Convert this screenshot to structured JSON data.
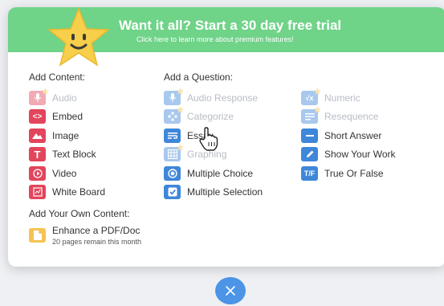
{
  "banner": {
    "title": "Want it all? Start a 30 day free trial",
    "subtitle": "Click here to learn more about premium features!"
  },
  "add_content": {
    "heading": "Add Content:",
    "items": [
      {
        "label": "Audio",
        "icon": "microphone-icon",
        "disabled": true,
        "premium": true
      },
      {
        "label": "Embed",
        "icon": "code-brackets-icon",
        "disabled": false
      },
      {
        "label": "Image",
        "icon": "mountain-image-icon",
        "disabled": false
      },
      {
        "label": "Text Block",
        "icon": "letter-t-icon",
        "disabled": false
      },
      {
        "label": "Video",
        "icon": "play-circle-icon",
        "disabled": false
      },
      {
        "label": "White Board",
        "icon": "whiteboard-icon",
        "disabled": false
      }
    ]
  },
  "add_question": {
    "heading": "Add a Question:",
    "col1": [
      {
        "label": "Audio Response",
        "icon": "microphone-icon",
        "disabled": true,
        "premium": true
      },
      {
        "label": "Categorize",
        "icon": "categorize-icon",
        "disabled": true,
        "premium": true
      },
      {
        "label": "Essay",
        "icon": "essay-lines-icon",
        "disabled": false
      },
      {
        "label": "Graphing",
        "icon": "grid-icon",
        "disabled": true,
        "premium": true
      },
      {
        "label": "Multiple Choice",
        "icon": "radio-target-icon",
        "disabled": false
      },
      {
        "label": "Multiple Selection",
        "icon": "checkbox-check-icon",
        "disabled": false
      }
    ],
    "col2": [
      {
        "label": "Numeric",
        "icon": "square-root-icon",
        "disabled": true,
        "premium": true
      },
      {
        "label": "Resequence",
        "icon": "resequence-icon",
        "disabled": true,
        "premium": true
      },
      {
        "label": "Short Answer",
        "icon": "short-line-icon",
        "disabled": false
      },
      {
        "label": "Show Your Work",
        "icon": "pencil-icon",
        "disabled": false
      },
      {
        "label": "True Or False",
        "icon": "true-false-icon",
        "disabled": false,
        "text": "T/F"
      }
    ]
  },
  "own_content": {
    "heading": "Add Your Own Content:",
    "title": "Enhance a PDF/Doc",
    "subtitle": "20 pages remain this month"
  },
  "colors": {
    "banner": "#6fd388",
    "content_red": "#e2455c",
    "question_blue": "#3f87d9",
    "pdf_yellow": "#f6c350",
    "close_button": "#4b94e6"
  }
}
